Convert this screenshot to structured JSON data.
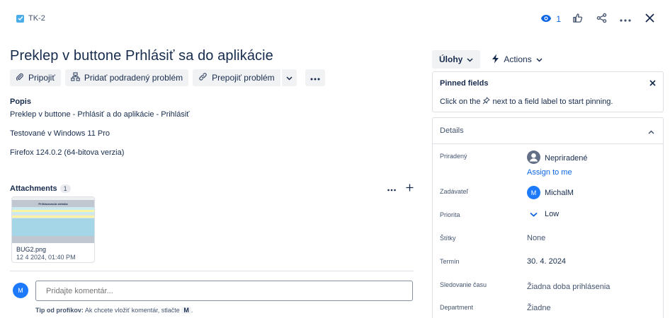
{
  "header": {
    "issue_key": "TK-2",
    "watch_count": "1",
    "icons": [
      "eye-icon",
      "like-icon",
      "share-icon",
      "more-icon",
      "close-icon"
    ]
  },
  "issue": {
    "title": "Preklep v buttone Prhlásiť sa do aplikácie",
    "actions": {
      "attach": "Pripojiť",
      "add_child": "Pridať podradený problém",
      "link_issue": "Prepojiť problém"
    },
    "description_label": "Popis",
    "description_lines": [
      "Preklep v buttone - Prhlásiť a do aplikácie - Prihlásiť",
      "Testované v Windows 11 Pro",
      "Firefox 124.0.2 (64-bitova verzia)"
    ]
  },
  "attachments": {
    "title": "Attachments",
    "count": "1",
    "items": [
      {
        "thumb_heading": "Prihlasovacia stránka",
        "name": "BUG2.png",
        "date": "12 4 2024, 01:40 PM"
      }
    ]
  },
  "comment": {
    "avatar_initial": "M",
    "placeholder": "Pridajte komentár...",
    "tip_label": "Tip od profíkov:",
    "tip_text": "Ak chcete vložiť komentár, stlačte",
    "tip_key": "M",
    "tip_end": "."
  },
  "sidebar": {
    "status_label": "Úlohy",
    "actions_label": "Actions",
    "pinned": {
      "title": "Pinned fields",
      "text_before": "Click on the",
      "text_after": "next to a field label to start pinning."
    },
    "details": {
      "title": "Details",
      "fields": [
        {
          "label": "Priradený",
          "value": "Nepriradené",
          "link": "Assign to me"
        },
        {
          "label": "Zadávateľ",
          "value": "MichalM",
          "avatar_initial": "M"
        },
        {
          "label": "Priorita",
          "value": "Low"
        },
        {
          "label": "Štítky",
          "value": "None"
        },
        {
          "label": "Termín",
          "value": "30. 4. 2024"
        },
        {
          "label": "Sledovanie času",
          "value": "Žiadna doba prihlásenia"
        },
        {
          "label": "Department",
          "value": "Žiadne"
        }
      ]
    }
  },
  "colors": {
    "accent": "#0c66e4",
    "avatar": "#1d7afc",
    "issue_type": "#4bade8"
  }
}
